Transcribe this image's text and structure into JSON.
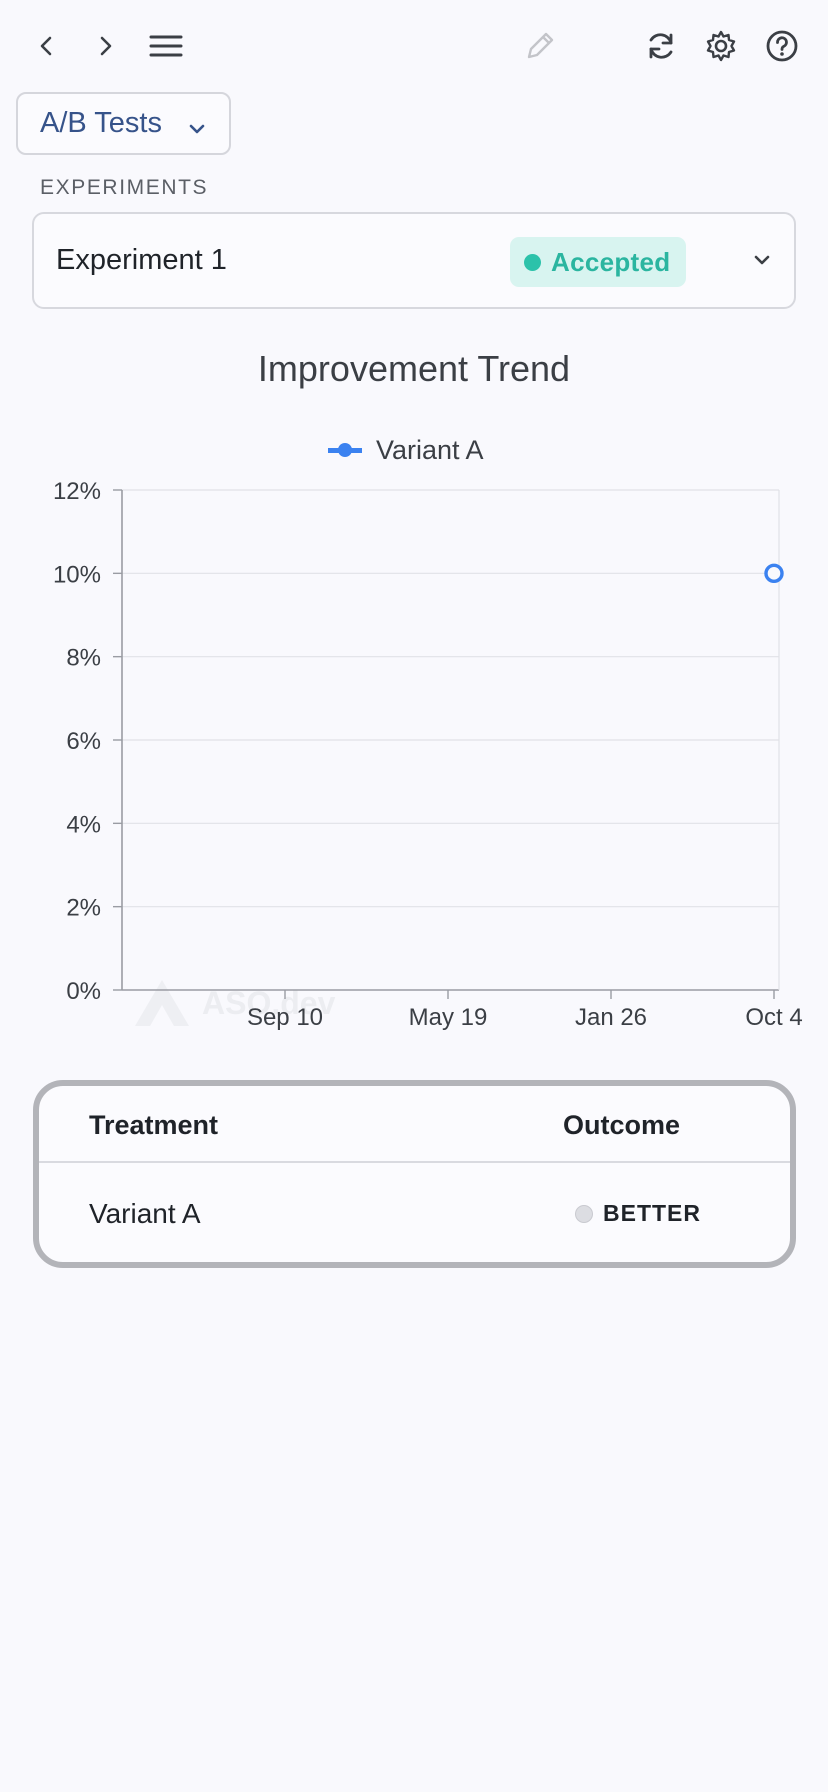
{
  "toolbar": {
    "icons": [
      "chevron-left-icon",
      "chevron-right-icon",
      "hamburger-menu-icon",
      "pencil-icon",
      "refresh-icon",
      "gear-icon",
      "help-circle-icon"
    ]
  },
  "section_select": {
    "label": "A/B Tests"
  },
  "experiments": {
    "heading": "EXPERIMENTS",
    "selected": {
      "name": "Experiment 1",
      "status": "Accepted"
    }
  },
  "watermark": {
    "text": "ASO.dev"
  },
  "colors": {
    "accent": "#3b82f0",
    "status_accepted_bg": "#d8f4f0",
    "status_accepted_text": "#2bb5a0",
    "link_text": "#36538a"
  },
  "chart_data": {
    "type": "line",
    "title": "Improvement Trend",
    "x_ticks": [
      "Sep 10",
      "May 19",
      "Jan 26",
      "Oct 4"
    ],
    "y_ticks": [
      "0%",
      "2%",
      "4%",
      "6%",
      "8%",
      "10%",
      "12%"
    ],
    "ylim": [
      0,
      12
    ],
    "grid": true,
    "legend_position": "top-center",
    "series": [
      {
        "name": "Variant A",
        "points": [
          {
            "x": "Oct 4",
            "y": 10
          }
        ]
      }
    ]
  },
  "results": {
    "columns": {
      "treatment": "Treatment",
      "outcome": "Outcome"
    },
    "rows": [
      {
        "treatment": "Variant A",
        "outcome": "BETTER"
      }
    ]
  }
}
